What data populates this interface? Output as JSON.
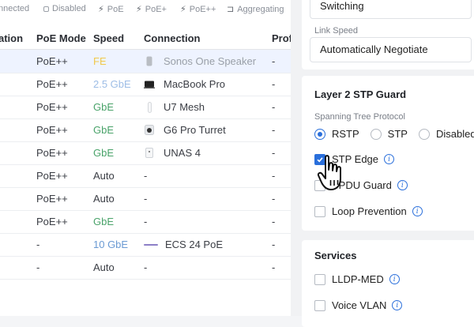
{
  "legend": [
    {
      "label": "nnected",
      "icon": "none"
    },
    {
      "label": "Disabled",
      "icon": "square-icon"
    },
    {
      "label": "PoE",
      "icon": "bolt-icon"
    },
    {
      "label": "PoE+",
      "icon": "bolt-plus-icon"
    },
    {
      "label": "PoE++",
      "icon": "bolt-plusplus-icon"
    },
    {
      "label": "Aggregating",
      "icon": "aggregate-icon"
    }
  ],
  "table": {
    "headers": {
      "col0": "ation",
      "mode": "PoE Mode",
      "speed": "Speed",
      "conn": "Connection",
      "prof": "Prof"
    },
    "rows": [
      {
        "mode": "PoE++",
        "speed": "FE",
        "speed_class": "fe",
        "conn": "Sonos One Speaker",
        "device_icon": "speaker-icon",
        "prof": "-",
        "selected": true,
        "muted": true
      },
      {
        "mode": "PoE++",
        "speed": "2.5 GbE",
        "speed_class": "2g",
        "conn": "MacBook Pro",
        "device_icon": "laptop-icon",
        "prof": "-"
      },
      {
        "mode": "PoE++",
        "speed": "GbE",
        "speed_class": "g",
        "conn": "U7 Mesh",
        "device_icon": "access-point-icon",
        "prof": "-"
      },
      {
        "mode": "PoE++",
        "speed": "GbE",
        "speed_class": "g",
        "conn": "G6 Pro Turret",
        "device_icon": "camera-icon",
        "prof": "-"
      },
      {
        "mode": "PoE++",
        "speed": "GbE",
        "speed_class": "g",
        "conn": "UNAS 4",
        "device_icon": "nas-icon",
        "prof": "-"
      },
      {
        "mode": "PoE++",
        "speed": "Auto",
        "speed_class": "auto",
        "conn": "-",
        "device_icon": "",
        "prof": "-"
      },
      {
        "mode": "PoE++",
        "speed": "Auto",
        "speed_class": "auto",
        "conn": "-",
        "device_icon": "",
        "prof": "-"
      },
      {
        "mode": "PoE++",
        "speed": "GbE",
        "speed_class": "g",
        "conn": "-",
        "device_icon": "",
        "prof": "-"
      },
      {
        "mode": "-",
        "speed": "10 GbE",
        "speed_class": "10g",
        "conn": "ECS 24 PoE",
        "device_icon": "link-line-icon",
        "prof": "-"
      },
      {
        "mode": "-",
        "speed": "Auto",
        "speed_class": "auto",
        "conn": "-",
        "device_icon": "",
        "prof": "-"
      }
    ]
  },
  "panel": {
    "top_select_value": "Switching",
    "link_speed_label": "Link Speed",
    "link_speed_value": "Automatically Negotiate",
    "stp": {
      "title": "Layer 2 STP Guard",
      "protocol_label": "Spanning Tree Protocol",
      "options": [
        "RSTP",
        "STP",
        "Disabled"
      ],
      "selected": "RSTP",
      "checks": [
        {
          "label": "STP Edge",
          "checked": true
        },
        {
          "label": "BPDU Guard",
          "checked": false
        },
        {
          "label": "Loop Prevention",
          "checked": false
        }
      ]
    },
    "services": {
      "title": "Services",
      "checks": [
        {
          "label": "LLDP-MED",
          "checked": false
        },
        {
          "label": "Voice VLAN",
          "checked": false
        }
      ]
    }
  },
  "colors": {
    "accent": "#2a6fdb",
    "selected_row": "#eef3ff"
  }
}
